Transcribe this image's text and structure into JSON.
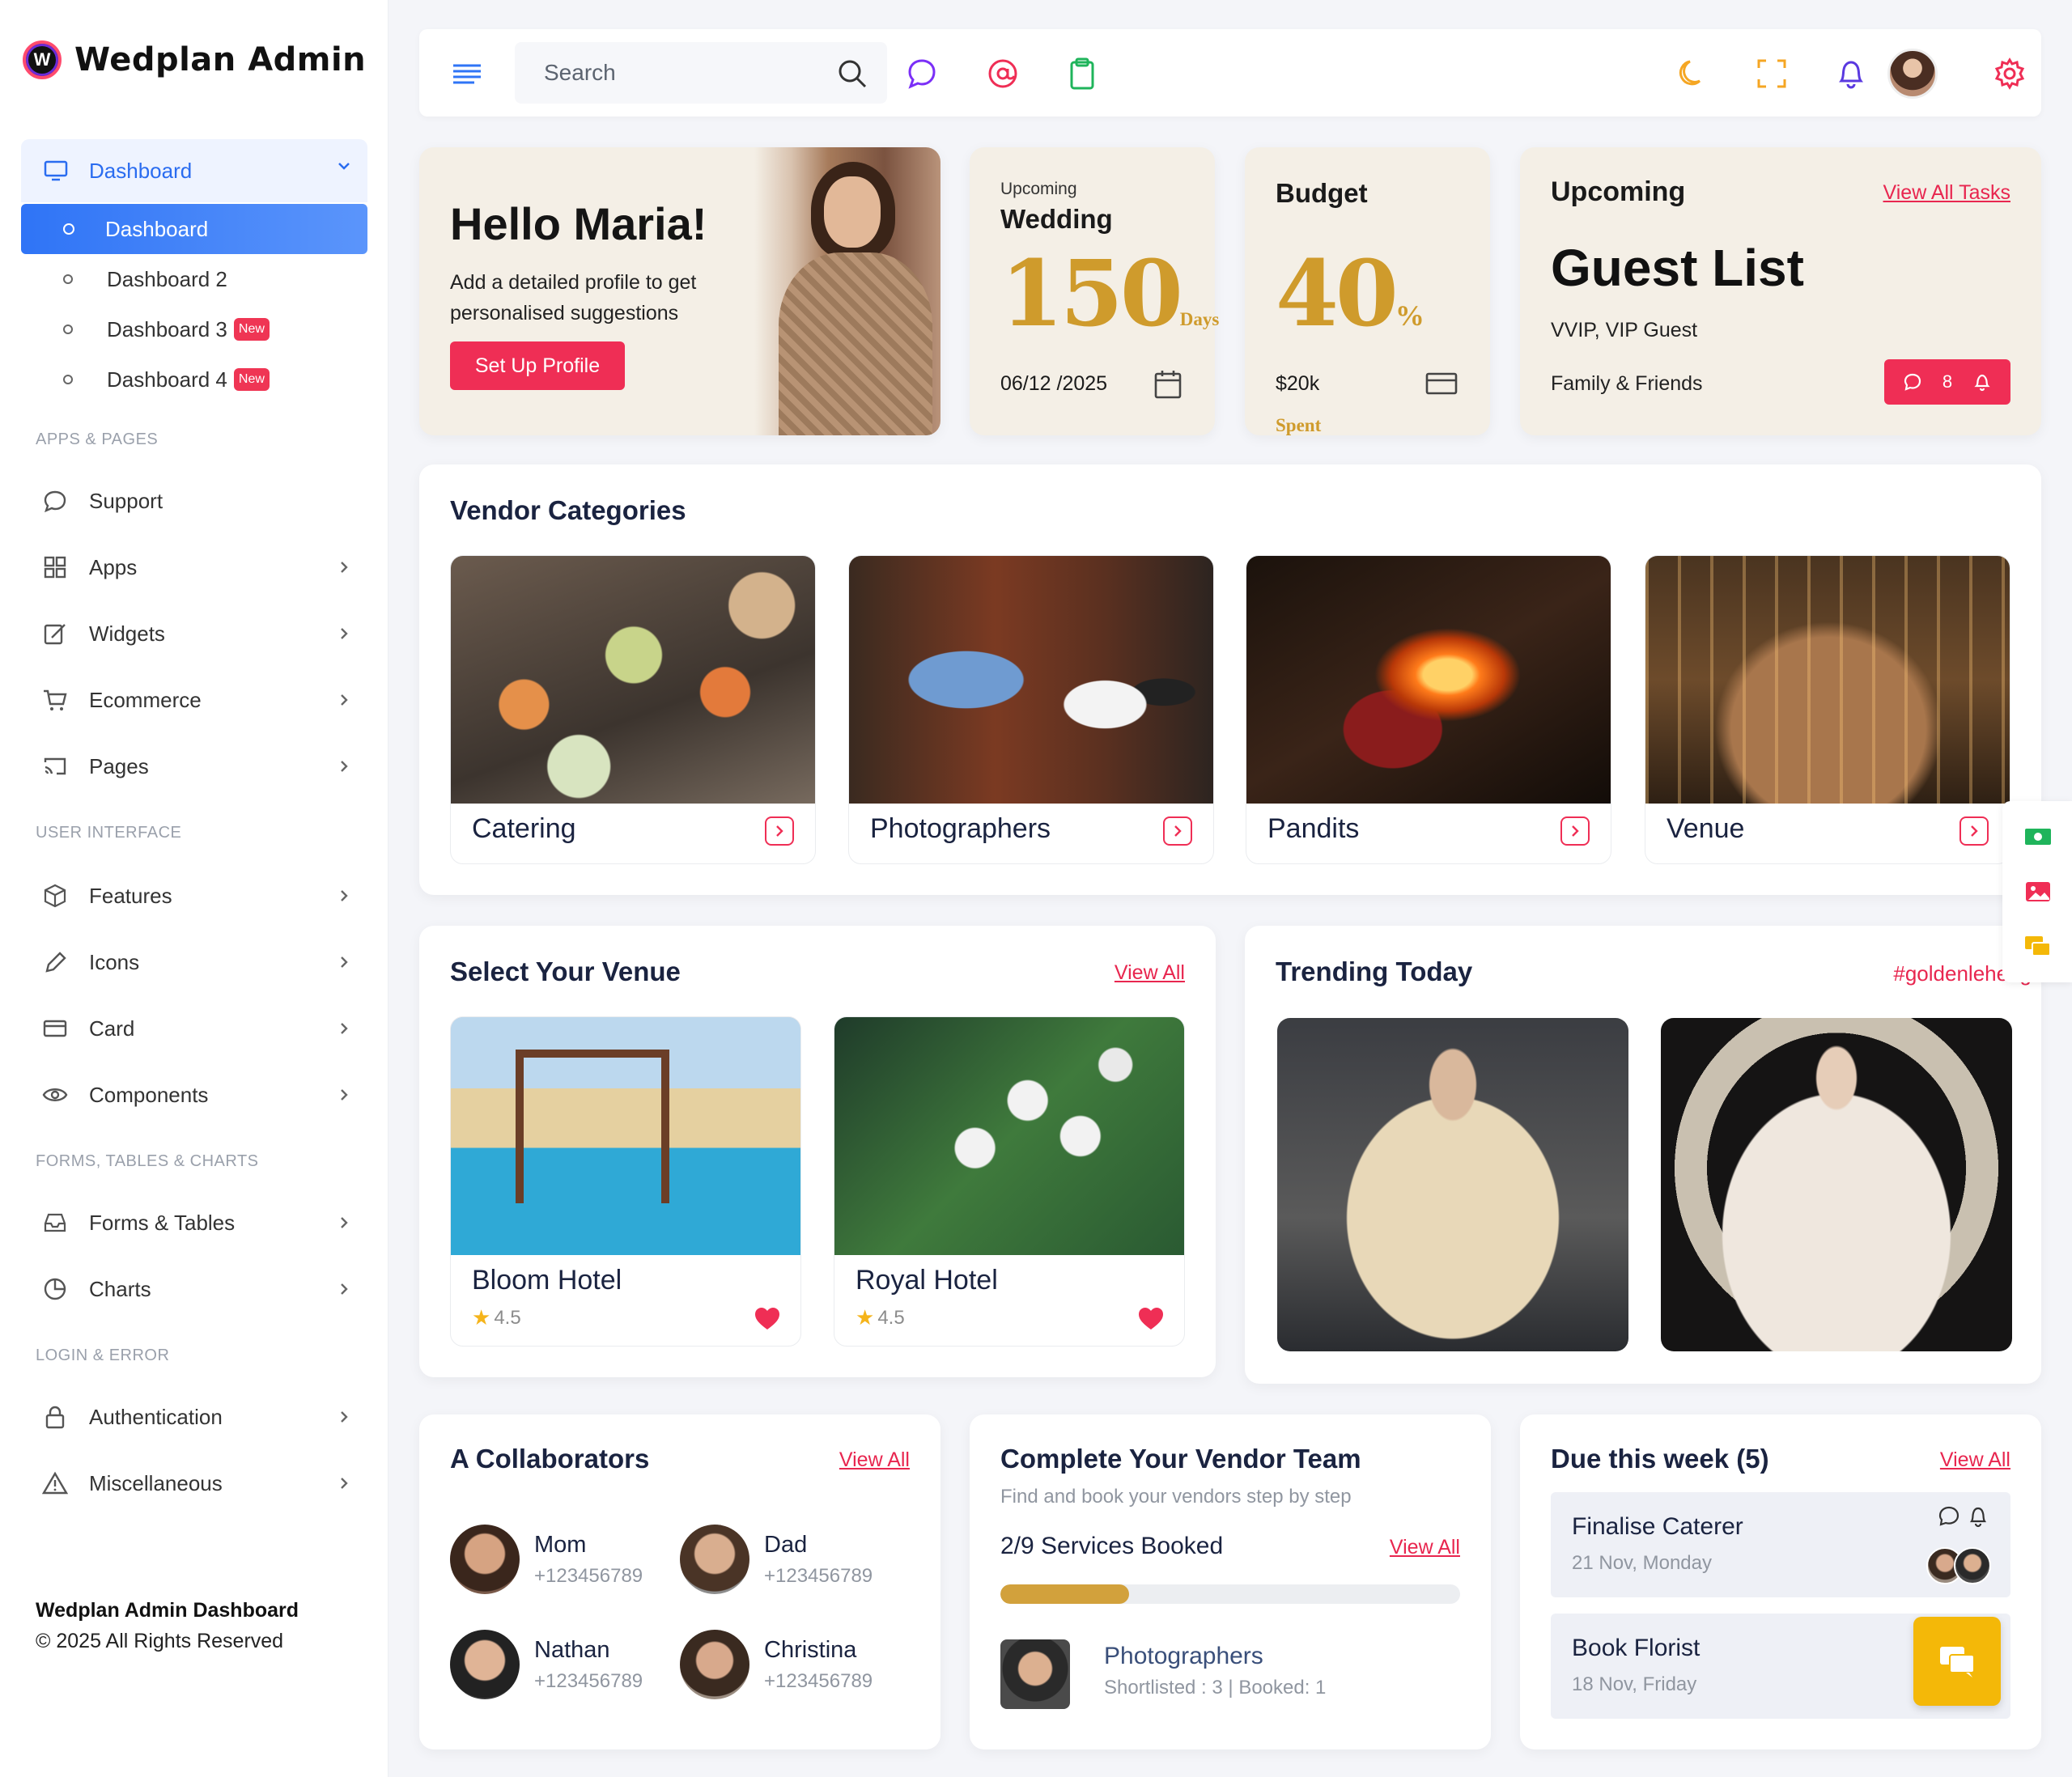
{
  "brand": {
    "name": "Wedplan Admin",
    "logo_letter": "W"
  },
  "sidebar": {
    "main": {
      "label": "Dashboard"
    },
    "sub_items": [
      {
        "label": "Dashboard",
        "badge": ""
      },
      {
        "label": "Dashboard 2",
        "badge": ""
      },
      {
        "label": "Dashboard 3",
        "badge": "New"
      },
      {
        "label": "Dashboard 4",
        "badge": "New"
      }
    ],
    "sections": {
      "apps": "APPS & PAGES",
      "ui": "USER INTERFACE",
      "forms": "FORMS, TABLES & CHARTS",
      "login": "LOGIN & ERROR"
    },
    "items": {
      "support": "Support",
      "apps": "Apps",
      "widgets": "Widgets",
      "ecommerce": "Ecommerce",
      "pages": "Pages",
      "features": "Features",
      "icons": "Icons",
      "card": "Card",
      "components": "Components",
      "forms_tables": "Forms & Tables",
      "charts": "Charts",
      "authentication": "Authentication",
      "miscellaneous": "Miscellaneous"
    },
    "footer": {
      "title": "Wedplan Admin Dashboard",
      "copyright": "© 2025 All Rights Reserved"
    }
  },
  "topbar": {
    "search_placeholder": "Search"
  },
  "hello": {
    "title": "Hello Maria!",
    "desc": "Add a detailed profile to get personalised suggestions",
    "button": "Set Up Profile"
  },
  "wedding": {
    "small": "Upcoming",
    "title": "Wedding",
    "number": "150",
    "unit": "Days",
    "date": "06/12 /2025"
  },
  "budget": {
    "title": "Budget",
    "number": "40",
    "unit_pct": "%",
    "unit": "Spent",
    "amount": "$20k"
  },
  "upcoming": {
    "title": "Upcoming",
    "link": "View All Tasks",
    "headline": "Guest List",
    "line1": "VVIP, VIP Guest",
    "line2": "Family & Friends",
    "count": "8"
  },
  "vendor": {
    "title": "Vendor Categories",
    "items": [
      {
        "label": "Catering"
      },
      {
        "label": "Photographers"
      },
      {
        "label": "Pandits"
      },
      {
        "label": "Venue"
      }
    ]
  },
  "venue": {
    "title": "Select Your Venue",
    "link": "View All",
    "hotels": [
      {
        "name": "Bloom Hotel",
        "rating": "4.5"
      },
      {
        "name": "Royal Hotel",
        "rating": "4.5"
      }
    ]
  },
  "trending": {
    "title": "Trending Today",
    "tag": "#goldenleheng"
  },
  "collaborators": {
    "title": "A Collaborators",
    "link": "View All",
    "people": [
      {
        "name": "Mom",
        "phone": "+123456789"
      },
      {
        "name": "Dad",
        "phone": "+123456789"
      },
      {
        "name": "Nathan",
        "phone": "+123456789"
      },
      {
        "name": "Christina",
        "phone": "+123456789"
      }
    ]
  },
  "team": {
    "title": "Complete Your Vendor Team",
    "subtitle": "Find and book your vendors step by step",
    "booked": "2/9 Services Booked",
    "progress": 0.28,
    "link": "View All",
    "vendor_name": "Photographers",
    "vendor_stats": "Shortlisted : 3 | Booked: 1"
  },
  "due": {
    "title": "Due this week (5)",
    "link": "View All",
    "tasks": [
      {
        "name": "Finalise Caterer",
        "date": "21 Nov, Monday"
      },
      {
        "name": "Book Florist",
        "date": "18 Nov, Friday"
      }
    ]
  },
  "colors": {
    "accent": "#2f74f6",
    "primary_red": "#ef2e55",
    "gold": "#cf9b2c",
    "beige": "#f4efe6"
  }
}
